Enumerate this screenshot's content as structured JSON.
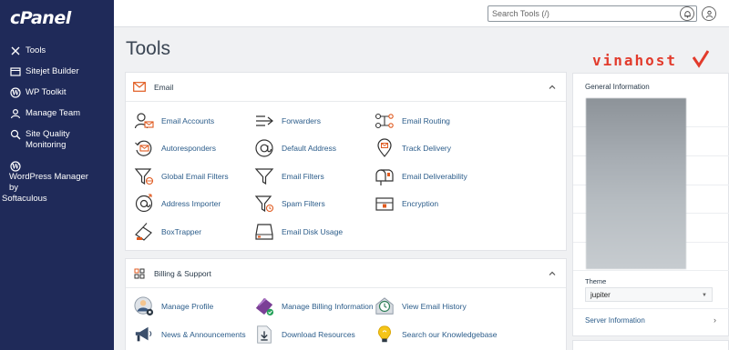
{
  "brand": {
    "logo": "cPanel"
  },
  "sidebar": {
    "items": [
      {
        "label": "Tools",
        "icon": "tools-icon"
      },
      {
        "label": "Sitejet Builder",
        "icon": "sitejet-icon"
      },
      {
        "label": "WP Toolkit",
        "icon": "wordpress-icon"
      },
      {
        "label": "Manage Team",
        "icon": "team-icon"
      },
      {
        "label": "Site Quality Monitoring",
        "icon": "magnifier-icon"
      },
      {
        "label": "WordPress Manager by",
        "extra": "Softaculous",
        "icon": "wordpress-icon"
      }
    ]
  },
  "topbar": {
    "search_placeholder": "Search Tools (/)"
  },
  "page": {
    "title": "Tools"
  },
  "email_section": {
    "title": "Email",
    "tools": [
      {
        "label": "Email Accounts",
        "icon": "email-accounts-icon"
      },
      {
        "label": "Forwarders",
        "icon": "forwarders-icon"
      },
      {
        "label": "Email Routing",
        "icon": "email-routing-icon"
      },
      {
        "label": "Autoresponders",
        "icon": "autoresponders-icon"
      },
      {
        "label": "Default Address",
        "icon": "at-sign-icon"
      },
      {
        "label": "Track Delivery",
        "icon": "location-pin-icon"
      },
      {
        "label": "Global Email Filters",
        "icon": "global-filter-icon"
      },
      {
        "label": "Email Filters",
        "icon": "filter-icon"
      },
      {
        "label": "Email Deliverability",
        "icon": "mailbox-icon"
      },
      {
        "label": "Address Importer",
        "icon": "address-importer-icon"
      },
      {
        "label": "Spam Filters",
        "icon": "spam-filter-icon"
      },
      {
        "label": "Encryption",
        "icon": "encryption-icon"
      },
      {
        "label": "BoxTrapper",
        "icon": "boxtrapper-icon"
      },
      {
        "label": "Email Disk Usage",
        "icon": "disk-usage-icon"
      }
    ]
  },
  "billing_section": {
    "title": "Billing & Support",
    "tools": [
      {
        "label": "Manage Profile",
        "icon": "profile-icon"
      },
      {
        "label": "Manage Billing Information",
        "icon": "billing-card-icon"
      },
      {
        "label": "View Email History",
        "icon": "email-history-icon"
      },
      {
        "label": "News & Announcements",
        "icon": "megaphone-icon"
      },
      {
        "label": "Download Resources",
        "icon": "download-icon"
      },
      {
        "label": "Search our Knowledgebase",
        "icon": "lightbulb-icon"
      }
    ]
  },
  "right": {
    "watermark": "vinahost",
    "general_info_title": "General Information",
    "theme_label": "Theme",
    "theme_value": "jupiter",
    "server_info": "Server Information"
  },
  "colors": {
    "sidebar": "#1f2a59",
    "accent_orange": "#f26b2a",
    "link": "#2b5c8a"
  }
}
